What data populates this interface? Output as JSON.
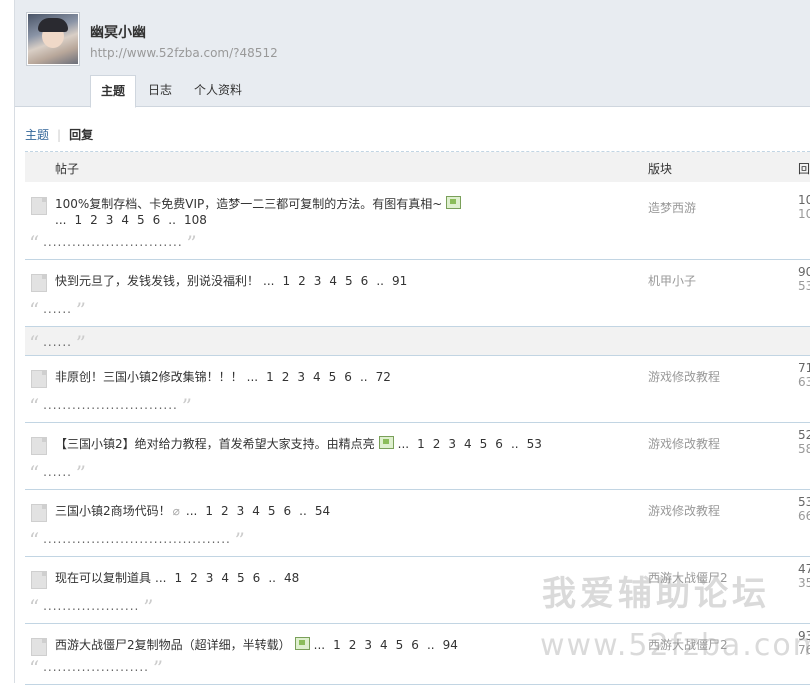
{
  "profile": {
    "username": "幽冥小幽",
    "url": "http://www.52fzba.com/?48512"
  },
  "tabs": [
    {
      "label": "主题",
      "active": true
    },
    {
      "label": "日志",
      "active": false
    },
    {
      "label": "个人资料",
      "active": false
    }
  ],
  "subnav": {
    "topics": "主题",
    "replies": "回复"
  },
  "table_header": {
    "post": "帖子",
    "forum": "版块",
    "reply": "回"
  },
  "rows": [
    {
      "title": "100%复制存档、卡免费VIP，造梦一二三都可复制的方法。有图有真相~",
      "has_image": true,
      "has_attach": false,
      "inline_pages": false,
      "pages": [
        "...",
        "1",
        "2",
        "3",
        "4",
        "5",
        "6",
        "..",
        "108"
      ],
      "forum": "造梦西游",
      "count1": "10",
      "count2": "10",
      "quote": "............................."
    },
    {
      "title": "快到元旦了，发钱发钱，别说没福利！",
      "has_image": false,
      "has_attach": false,
      "inline_pages": true,
      "pages": [
        "...",
        "1",
        "2",
        "3",
        "4",
        "5",
        "6",
        "..",
        "91"
      ],
      "forum": "机甲小子",
      "count1": "90",
      "count2": "53",
      "quote": "......"
    },
    {
      "title": "非原创！三国小镇2修改集锦！！！",
      "has_image": false,
      "has_attach": false,
      "inline_pages": true,
      "pages": [
        "...",
        "1",
        "2",
        "3",
        "4",
        "5",
        "6",
        "..",
        "72"
      ],
      "forum": "游戏修改教程",
      "count1": "71",
      "count2": "63",
      "quote": "............................"
    },
    {
      "title": "【三国小镇2】绝对给力教程，首发希望大家支持。由精点亮",
      "has_image": true,
      "has_attach": false,
      "inline_pages": true,
      "pages": [
        "...",
        "1",
        "2",
        "3",
        "4",
        "5",
        "6",
        "..",
        "53"
      ],
      "forum": "游戏修改教程",
      "count1": "52",
      "count2": "58",
      "quote": "......"
    },
    {
      "title": "三国小镇2商场代码！",
      "has_image": false,
      "has_attach": true,
      "inline_pages": true,
      "pages": [
        "...",
        "1",
        "2",
        "3",
        "4",
        "5",
        "6",
        "..",
        "54"
      ],
      "forum": "游戏修改教程",
      "count1": "53",
      "count2": "66",
      "quote": "......................................."
    },
    {
      "title": "现在可以复制道具",
      "has_image": false,
      "has_attach": false,
      "inline_pages": true,
      "pages": [
        "...",
        "1",
        "2",
        "3",
        "4",
        "5",
        "6",
        "..",
        "48"
      ],
      "forum": "西游大战僵尸2",
      "count1": "47",
      "count2": "35",
      "quote": "...................."
    },
    {
      "title": "西游大战僵尸2复制物品（超详细，半转载）",
      "has_image": true,
      "has_attach": false,
      "inline_pages": true,
      "pages": [
        "...",
        "1",
        "2",
        "3",
        "4",
        "5",
        "6",
        "..",
        "94"
      ],
      "forum": "西游大战僵尸2",
      "count1": "93",
      "count2": "76",
      "quote": "......................"
    }
  ],
  "graybar_quote": "......",
  "watermark": {
    "line1": "我爱辅助论坛",
    "line2": "www.52fzba.com"
  }
}
